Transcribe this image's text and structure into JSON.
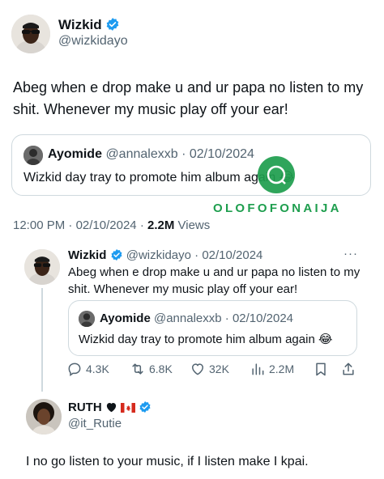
{
  "main_tweet": {
    "author_name": "Wizkid",
    "author_handle": "@wizkidayo",
    "text": "Abeg when e drop make u and ur papa no listen to my shit. Whenever my music play off your ear!",
    "time": "12:00 PM",
    "date": "02/10/2024",
    "views_count": "2.2M",
    "views_label": "Views",
    "quote": {
      "author_name": "Ayomide",
      "author_handle": "@annalexxb",
      "date": "02/10/2024",
      "text": "Wizkid day tray to promote him album again",
      "emoji": "😂"
    }
  },
  "watermark": {
    "text": "OLOFOFONAIJA",
    "color": "#1e9e4e"
  },
  "reply_tweet": {
    "author_name": "Wizkid",
    "author_handle": "@wizkidayo",
    "date": "02/10/2024",
    "line1": "Abeg when e drop make u and ur papa no listen to my",
    "line2": "shit. Whenever my music play off your ear!",
    "more": "···",
    "quote": {
      "author_name": "Ayomide",
      "author_handle": "@annalexxb",
      "date": "02/10/2024",
      "text": "Wizkid day tray to promote him album again",
      "emoji": "😂"
    },
    "actions": {
      "replies": "4.3K",
      "reposts": "6.8K",
      "likes": "32K",
      "views": "2.2M"
    }
  },
  "bottom_tweet": {
    "author_name": "RUTH",
    "author_handle": "@it_Rutie",
    "text": "I no go listen to your music, if I listen make I kpai."
  },
  "colors": {
    "verified": "#1d9bf0",
    "secondary_text": "#536471",
    "border": "#cfd9de"
  }
}
